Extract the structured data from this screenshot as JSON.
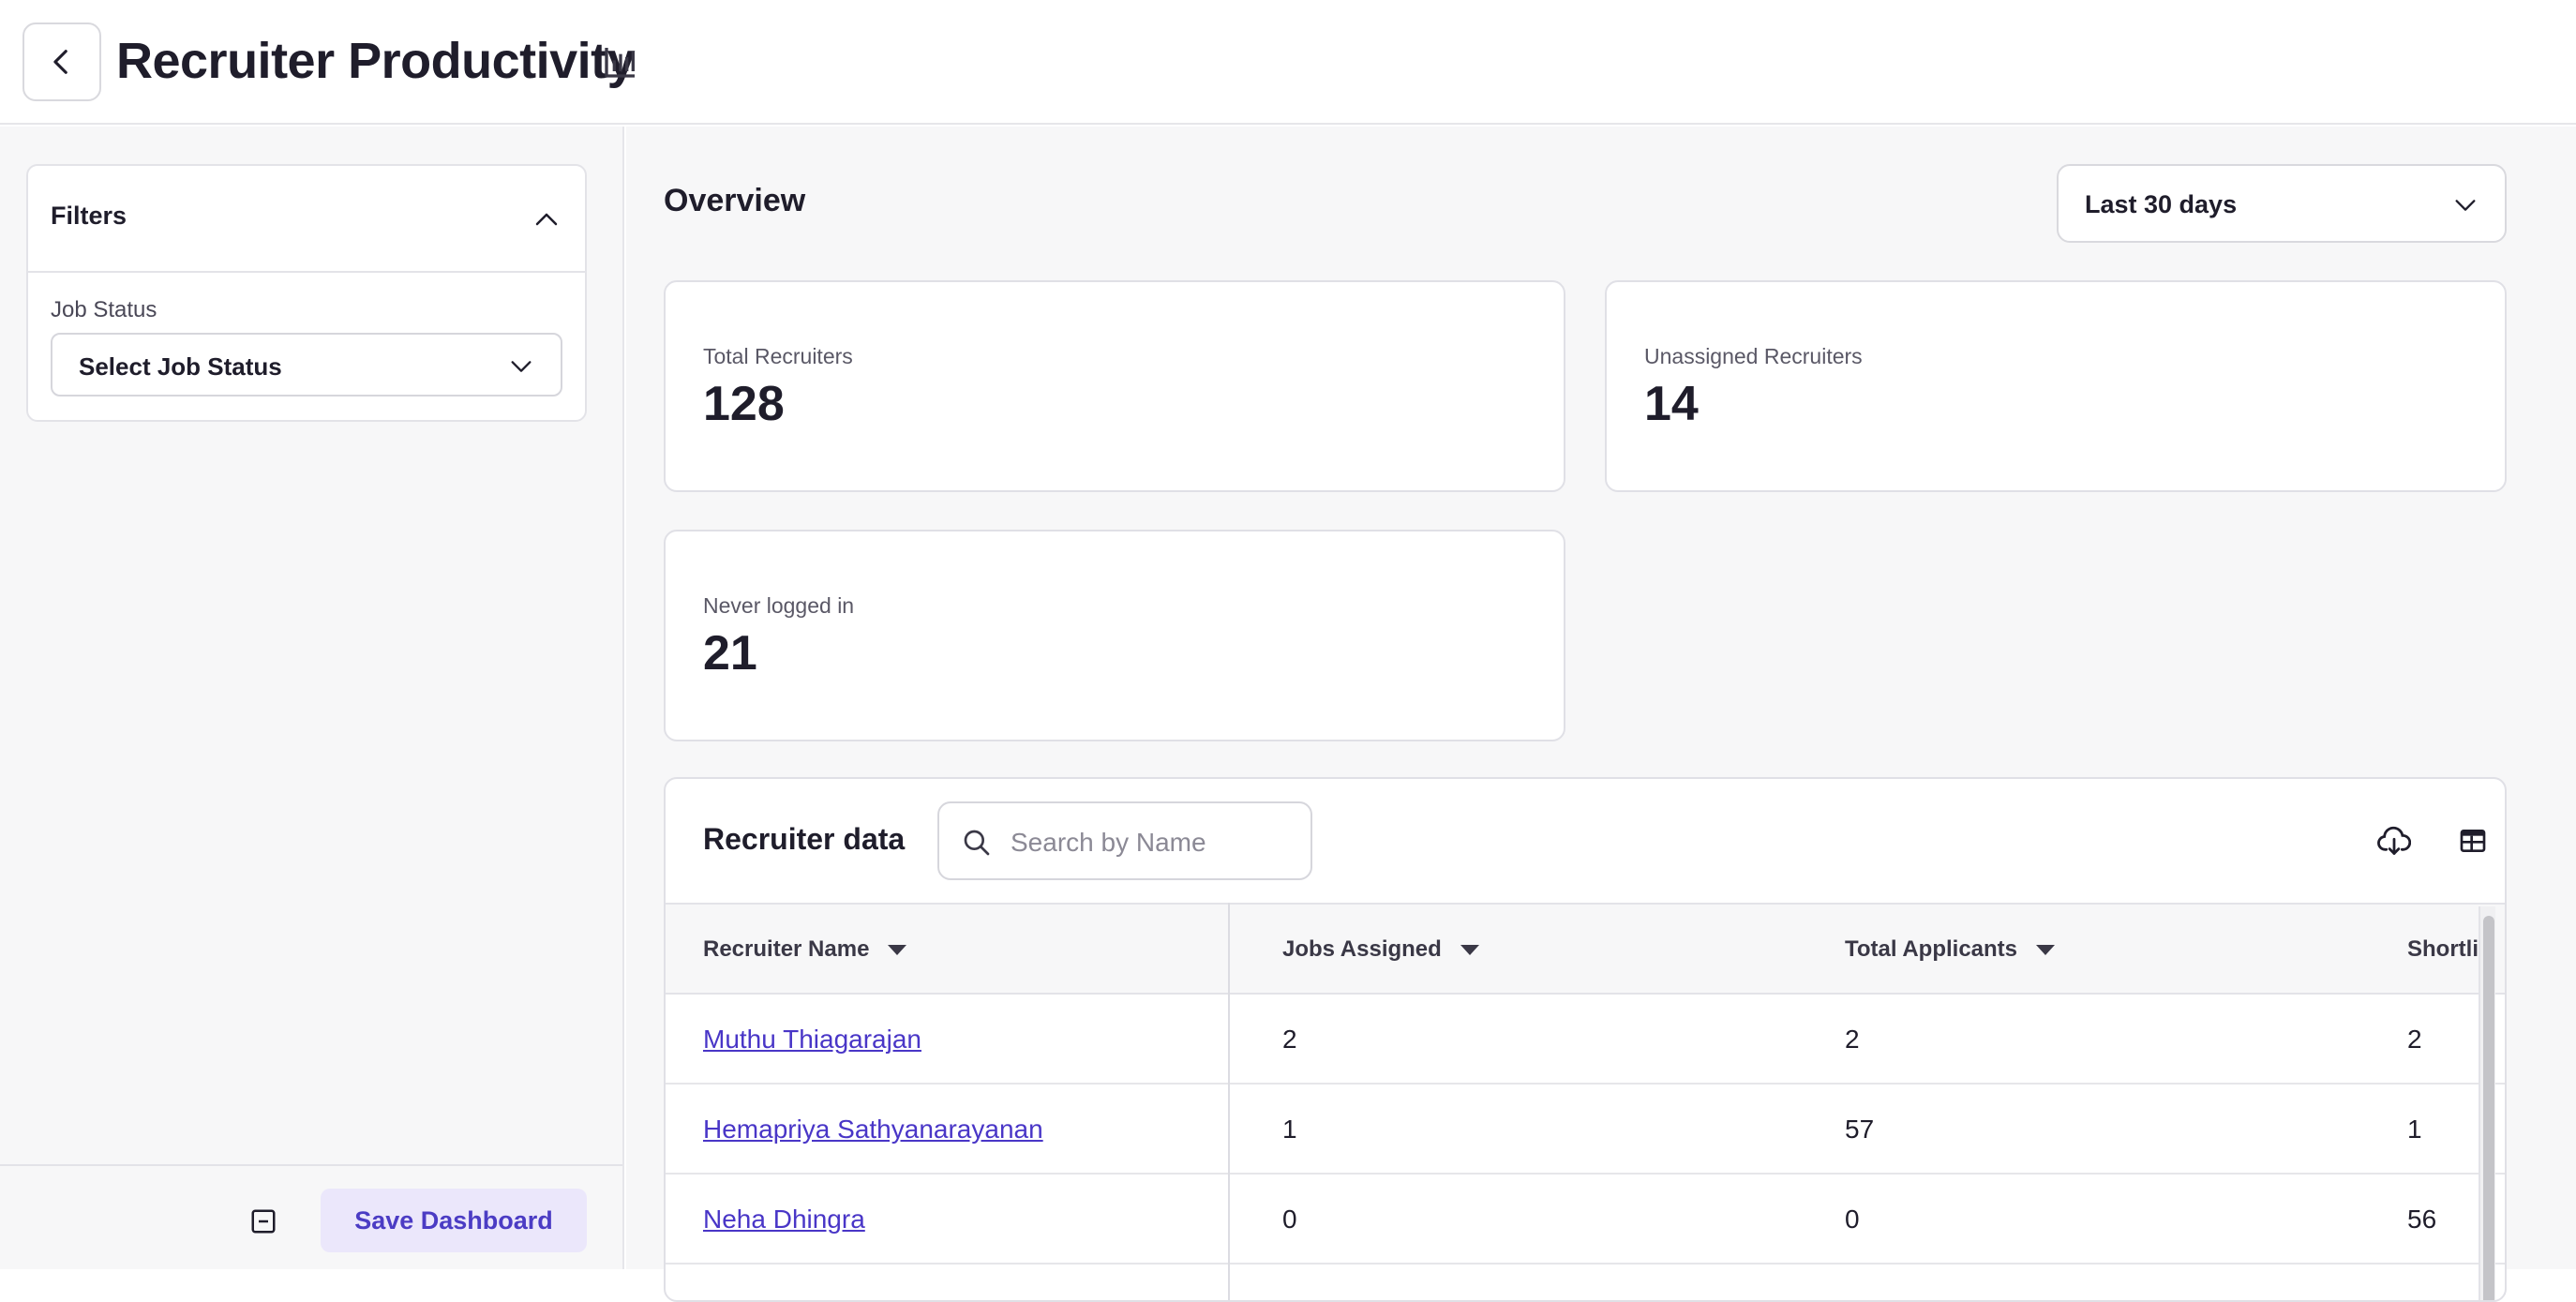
{
  "header": {
    "title": "Recruiter Productivity",
    "back_icon": "chevron-left-icon",
    "title_icon": "bar-chart-icon"
  },
  "sidebar": {
    "filters_title": "Filters",
    "job_status_label": "Job Status",
    "job_status_value": "Select Job Status",
    "save_label": "Save Dashboard",
    "collapse_icon": "collapse-icon"
  },
  "overview": {
    "title": "Overview",
    "date_range": "Last 30 days",
    "stats": [
      {
        "label": "Total Recruiters",
        "value": "128"
      },
      {
        "label": "Unassigned Recruiters",
        "value": "14"
      },
      {
        "label": "Never logged in",
        "value": "21"
      }
    ]
  },
  "recruiter_table": {
    "title": "Recruiter data",
    "search_placeholder": "Search by Name",
    "columns": [
      "Recruiter Name",
      "Jobs Assigned",
      "Total Applicants",
      "Shortlisted"
    ],
    "rows": [
      {
        "name": "Muthu Thiagarajan",
        "jobs_assigned": "2",
        "total_applicants": "2",
        "shortlisted": "2"
      },
      {
        "name": "Hemapriya Sathyanarayanan",
        "jobs_assigned": "1",
        "total_applicants": "57",
        "shortlisted": "1"
      },
      {
        "name": "Neha Dhingra",
        "jobs_assigned": "0",
        "total_applicants": "0",
        "shortlisted": "56"
      }
    ]
  },
  "colors": {
    "accent": "#4b3cc4",
    "link": "#4936c7",
    "save_button_bg": "#ebe7fb",
    "page_bg": "#f7f7f8"
  }
}
